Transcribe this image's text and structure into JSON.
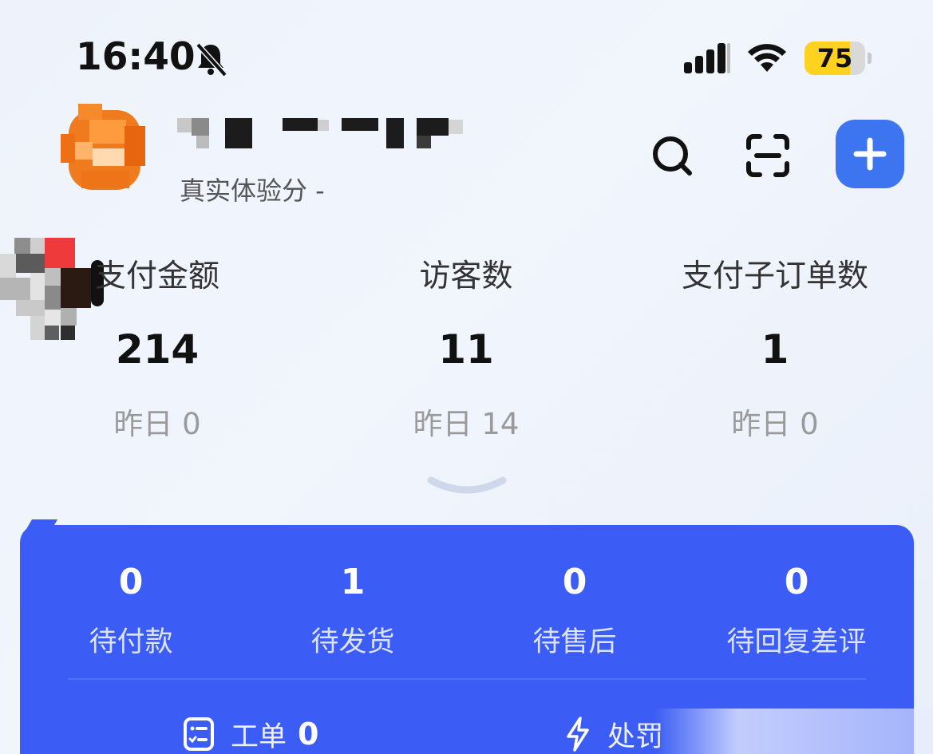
{
  "status_bar": {
    "time": "16:40",
    "battery_level": "75",
    "battery_fraction": 0.75,
    "icons": [
      "bell-muted-icon",
      "signal-icon",
      "wifi-icon",
      "battery-icon"
    ]
  },
  "header": {
    "score_label": "真实体验分 -",
    "actions": [
      "search-icon",
      "scan-icon",
      "add-icon"
    ],
    "accent_color": "#3d74f0"
  },
  "metrics": [
    {
      "label": "支付金额",
      "value": "214",
      "yesterday": "昨日 0"
    },
    {
      "label": "访客数",
      "value": "11",
      "yesterday": "昨日 14"
    },
    {
      "label": "支付子订单数",
      "value": "1",
      "yesterday": "昨日 0"
    }
  ],
  "orders_card": {
    "color": "#3b5cf5",
    "items": [
      {
        "count": "0",
        "label": "待付款"
      },
      {
        "count": "1",
        "label": "待发货"
      },
      {
        "count": "0",
        "label": "待售后"
      },
      {
        "count": "0",
        "label": "待回复差评"
      }
    ],
    "bottom": [
      {
        "icon": "work-order-icon",
        "label": "工单",
        "value": "0"
      },
      {
        "icon": "lightning-icon",
        "label": "处罚",
        "value": ""
      }
    ]
  }
}
